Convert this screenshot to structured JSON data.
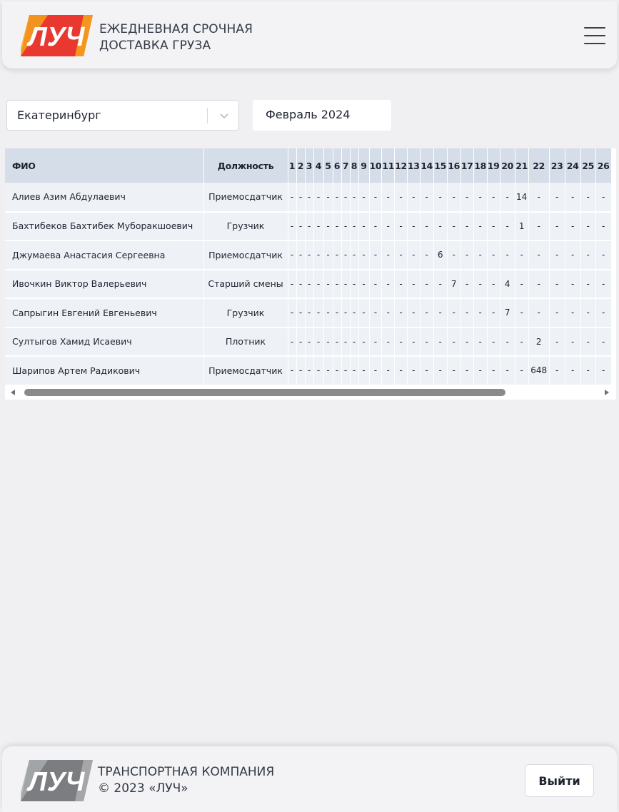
{
  "header": {
    "logo_text": "ЛУЧ",
    "title_line1": "ЕЖЕДНЕВНАЯ СРОЧНАЯ",
    "title_line2": "ДОСТАВКА ГРУЗА",
    "menu_icon": "hamburger-menu-icon"
  },
  "filters": {
    "city": "Екатеринбург",
    "city_dropdown_icon": "chevron-down-icon",
    "month": "Февраль 2024"
  },
  "table": {
    "col_name": "ФИО",
    "col_position": "Должность",
    "days": [
      "1",
      "2",
      "3",
      "4",
      "5",
      "6",
      "7",
      "8",
      "9",
      "10",
      "11",
      "12",
      "13",
      "14",
      "15",
      "16",
      "17",
      "18",
      "19",
      "20",
      "21",
      "22",
      "23",
      "24",
      "25",
      "26"
    ],
    "rows": [
      {
        "name": "Алиев Азим Абдулаевич",
        "position": "Приемосдатчик",
        "values": [
          "-",
          "-",
          "-",
          "-",
          "-",
          "-",
          "-",
          "-",
          "-",
          "-",
          "-",
          "-",
          "-",
          "-",
          "-",
          "-",
          "-",
          "-",
          "-",
          "-",
          "14",
          "-",
          "-",
          "-",
          "-",
          "-"
        ]
      },
      {
        "name": "Бахтибеков Бахтибек Муборакшоевич",
        "position": "Грузчик",
        "values": [
          "-",
          "-",
          "-",
          "-",
          "-",
          "-",
          "-",
          "-",
          "-",
          "-",
          "-",
          "-",
          "-",
          "-",
          "-",
          "-",
          "-",
          "-",
          "-",
          "-",
          "1",
          "-",
          "-",
          "-",
          "-",
          "-"
        ]
      },
      {
        "name": "Джумаева Анастасия Сергеевна",
        "position": "Приемосдатчик",
        "values": [
          "-",
          "-",
          "-",
          "-",
          "-",
          "-",
          "-",
          "-",
          "-",
          "-",
          "-",
          "-",
          "-",
          "-",
          "6",
          "-",
          "-",
          "-",
          "-",
          "-",
          "-",
          "-",
          "-",
          "-",
          "-",
          "-"
        ]
      },
      {
        "name": "Ивочкин Виктор Валерьевич",
        "position": "Старший смены",
        "values": [
          "-",
          "-",
          "-",
          "-",
          "-",
          "-",
          "-",
          "-",
          "-",
          "-",
          "-",
          "-",
          "-",
          "-",
          "-",
          "7",
          "-",
          "-",
          "-",
          "4",
          "-",
          "-",
          "-",
          "-",
          "-",
          "-"
        ]
      },
      {
        "name": "Сапрыгин Евгений Евгеньевич",
        "position": "Грузчик",
        "values": [
          "-",
          "-",
          "-",
          "-",
          "-",
          "-",
          "-",
          "-",
          "-",
          "-",
          "-",
          "-",
          "-",
          "-",
          "-",
          "-",
          "-",
          "-",
          "-",
          "7",
          "-",
          "-",
          "-",
          "-",
          "-",
          "-"
        ]
      },
      {
        "name": "Султыгов Хамид Исаевич",
        "position": "Плотник",
        "values": [
          "-",
          "-",
          "-",
          "-",
          "-",
          "-",
          "-",
          "-",
          "-",
          "-",
          "-",
          "-",
          "-",
          "-",
          "-",
          "-",
          "-",
          "-",
          "-",
          "-",
          "-",
          "2",
          "-",
          "-",
          "-",
          "-"
        ]
      },
      {
        "name": "Шарипов Артем Радикович",
        "position": "Приемосдатчик",
        "values": [
          "-",
          "-",
          "-",
          "-",
          "-",
          "-",
          "-",
          "-",
          "-",
          "-",
          "-",
          "-",
          "-",
          "-",
          "-",
          "-",
          "-",
          "-",
          "-",
          "-",
          "-",
          "648",
          "-",
          "-",
          "-",
          "-"
        ]
      }
    ]
  },
  "footer": {
    "logo_text": "ЛУЧ",
    "line1": "ТРАНСПОРТНАЯ КОМПАНИЯ",
    "line2": "© 2023 «ЛУЧ»",
    "logout_label": "Выйти"
  },
  "colors": {
    "background": "#f0f0f3",
    "table_header": "#d5dde8",
    "table_cell": "#eef1f6",
    "logo_red": "#e8382f",
    "logo_orange": "#f6a21c",
    "logo_gray": "#7b7d80"
  }
}
